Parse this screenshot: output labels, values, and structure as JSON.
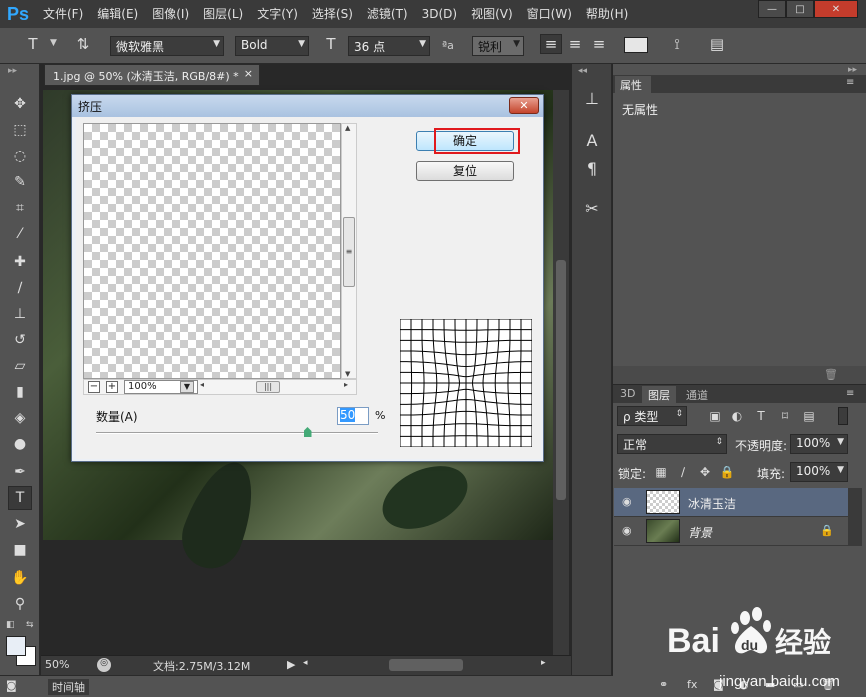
{
  "app": {
    "logo": "Ps"
  },
  "menu": [
    "文件(F)",
    "编辑(E)",
    "图像(I)",
    "图层(L)",
    "文字(Y)",
    "选择(S)",
    "滤镜(T)",
    "3D(D)",
    "视图(V)",
    "窗口(W)",
    "帮助(H)"
  ],
  "window_controls": {
    "minimize": "—",
    "maximize": "□",
    "close": "✕"
  },
  "options": {
    "tool_glyph": "T",
    "font_family": "微软雅黑",
    "font_style": "Bold",
    "font_size": "36 点",
    "aa_label": "ªa",
    "antialias": "锐利"
  },
  "document": {
    "tab_title": "1.jpg @ 50% (冰清玉洁, RGB/8#) *",
    "tab_close": "×",
    "zoom": "50%",
    "doc_info": "文档:2.75M/3.12M"
  },
  "timeline": {
    "label": "时间轴"
  },
  "dialog": {
    "title": "挤压",
    "close": "✕",
    "ok_label": "确定",
    "reset_label": "复位",
    "preview_zoom": "100%",
    "amount_label": "数量(A)",
    "amount_value": "50",
    "amount_unit": "%",
    "amount_fraction": 0.75
  },
  "properties": {
    "tab": "属性",
    "content": "无属性"
  },
  "layers": {
    "tabs": [
      "3D",
      "图层",
      "通道"
    ],
    "active_tab": 1,
    "filter_kind": "ρ 类型",
    "blend_mode": "正常",
    "opacity_label": "不透明度:",
    "opacity_value": "100%",
    "lock_label": "锁定:",
    "fill_label": "填充:",
    "fill_value": "100%",
    "items": [
      {
        "name": "冰清玉洁",
        "selected": true
      },
      {
        "name": "背景",
        "locked": true
      }
    ]
  },
  "watermark": {
    "brand": "Bai",
    "brand2": "du",
    "service": "经验",
    "url": "jingyan.baidu.com"
  },
  "colors": {
    "accent": "#31a8ff",
    "highlight_box": "#e0191d",
    "selected_layer": "#596880"
  }
}
